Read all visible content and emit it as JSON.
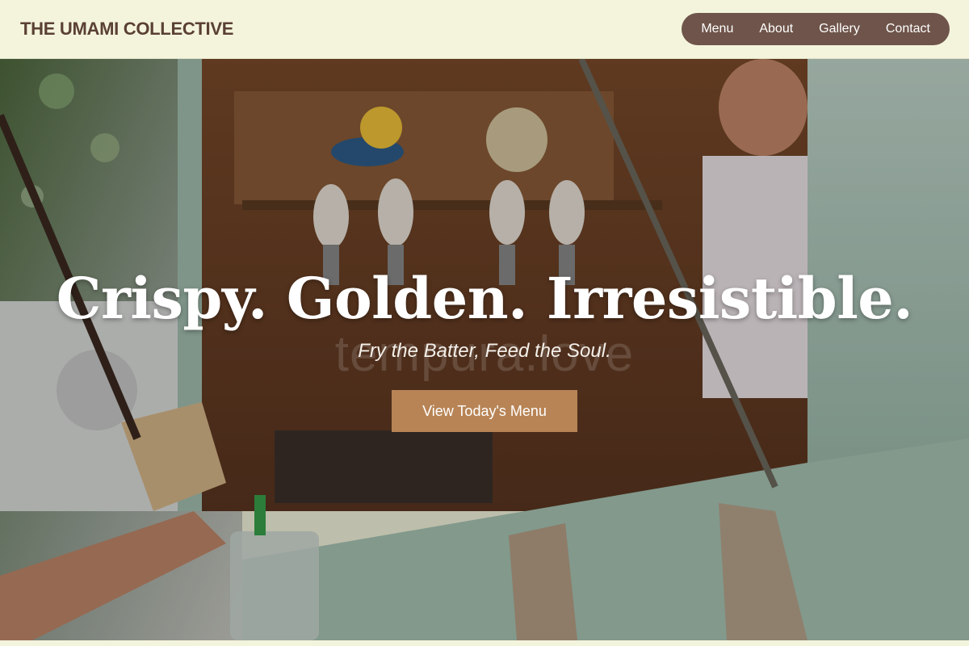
{
  "brand": {
    "name": "THE UMAMI COLLECTIVE"
  },
  "nav": {
    "items": [
      {
        "label": "Menu"
      },
      {
        "label": "About"
      },
      {
        "label": "Gallery"
      },
      {
        "label": "Contact"
      }
    ]
  },
  "hero": {
    "title": "Crispy. Golden. Irresistible.",
    "subtitle": "Fry the Batter, Feed the Soul.",
    "watermark": "tempura.love",
    "cta_label": "View Today's Menu",
    "image_alt": "Food truck service window with beer taps and a server handing food to a customer"
  },
  "colors": {
    "header_bg": "#f4f4dc",
    "brand_text": "#5a4034",
    "nav_bg": "#6e544a",
    "cta_bg": "#b88455",
    "truck_mint": "#a9c6b6"
  }
}
